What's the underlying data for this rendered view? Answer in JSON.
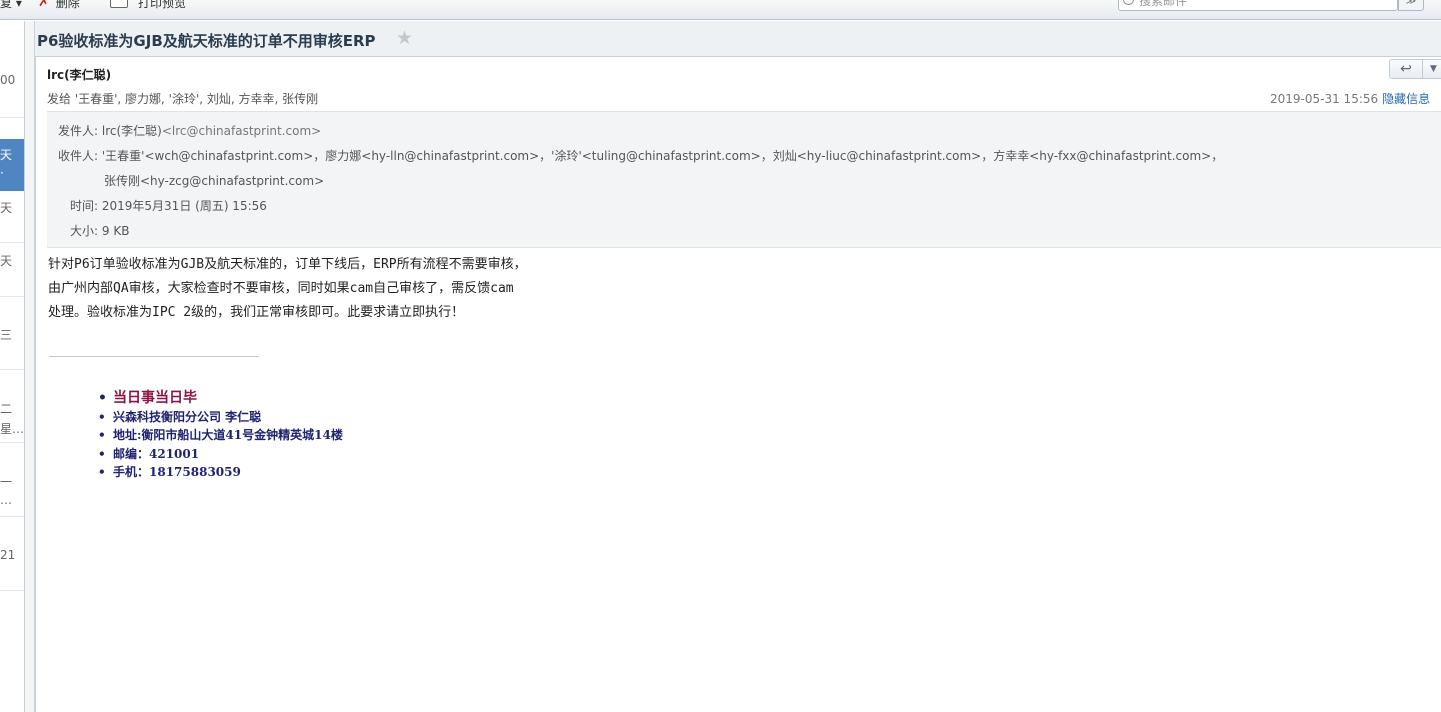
{
  "toolbar": {
    "cut_label": "复 ▾",
    "delete_label": "删除",
    "print_label": "打印预览",
    "search_placeholder": "搜索邮件",
    "search_dropdown": "≫"
  },
  "message_list": {
    "rows": [
      "00",
      "天",
      "天",
      "天",
      "三",
      "二",
      "星…",
      "一",
      "…",
      "21"
    ],
    "selected": [
      "天",
      "·"
    ]
  },
  "message": {
    "subject": "P6验收标准为GJB及航天标准的订单不用审核ERP",
    "star": "★",
    "sender": "lrc(李仁聪)",
    "to_summary": "发给 '王春重', 廖力娜, '涂玲', 刘灿, 方幸幸, 张传刚",
    "date_short": "2019-05-31 15:56",
    "hide_info": "隐藏信息",
    "reply_icon": "↩",
    "more_icon": "▼",
    "details": {
      "from_label": "发件人:",
      "from_name": "lrc(李仁聪)",
      "from_addr": "<lrc@chinafastprint.com>",
      "to_label": "收件人:",
      "to_line1": "'王春重'<wch@chinafastprint.com>，廖力娜<hy-lln@chinafastprint.com>，'涂玲'<tuling@chinafastprint.com>，刘灿<hy-liuc@chinafastprint.com>，方幸幸<hy-fxx@chinafastprint.com>，",
      "to_line2": "张传刚<hy-zcg@chinafastprint.com>",
      "time_label": "时间:",
      "time_value": "2019年5月31日 (周五) 15:56",
      "size_label": "大小:",
      "size_value": "9 KB"
    },
    "body_lines": [
      "针对P6订单验收标准为GJB及航天标准的，订单下线后，ERP所有流程不需要审核，",
      "由广州内部QA审核，大家检查时不要审核，同时如果cam自己审核了，需反馈cam",
      "处理。验收标准为IPC 2级的，我们正常审核即可。此要求请立即执行！"
    ],
    "signature": [
      "当日事当日毕",
      " 兴森科技衡阳分公司   李仁聪",
      "地址:衡阳市船山大道41号金钟精英城14楼",
      "邮编：421001",
      "手机：18175883059"
    ]
  },
  "colors": {
    "selected_row": "#4f86c2",
    "link": "#2a6ab0",
    "signature_text": "#1f2370",
    "signature_motto": "#8e1446"
  }
}
